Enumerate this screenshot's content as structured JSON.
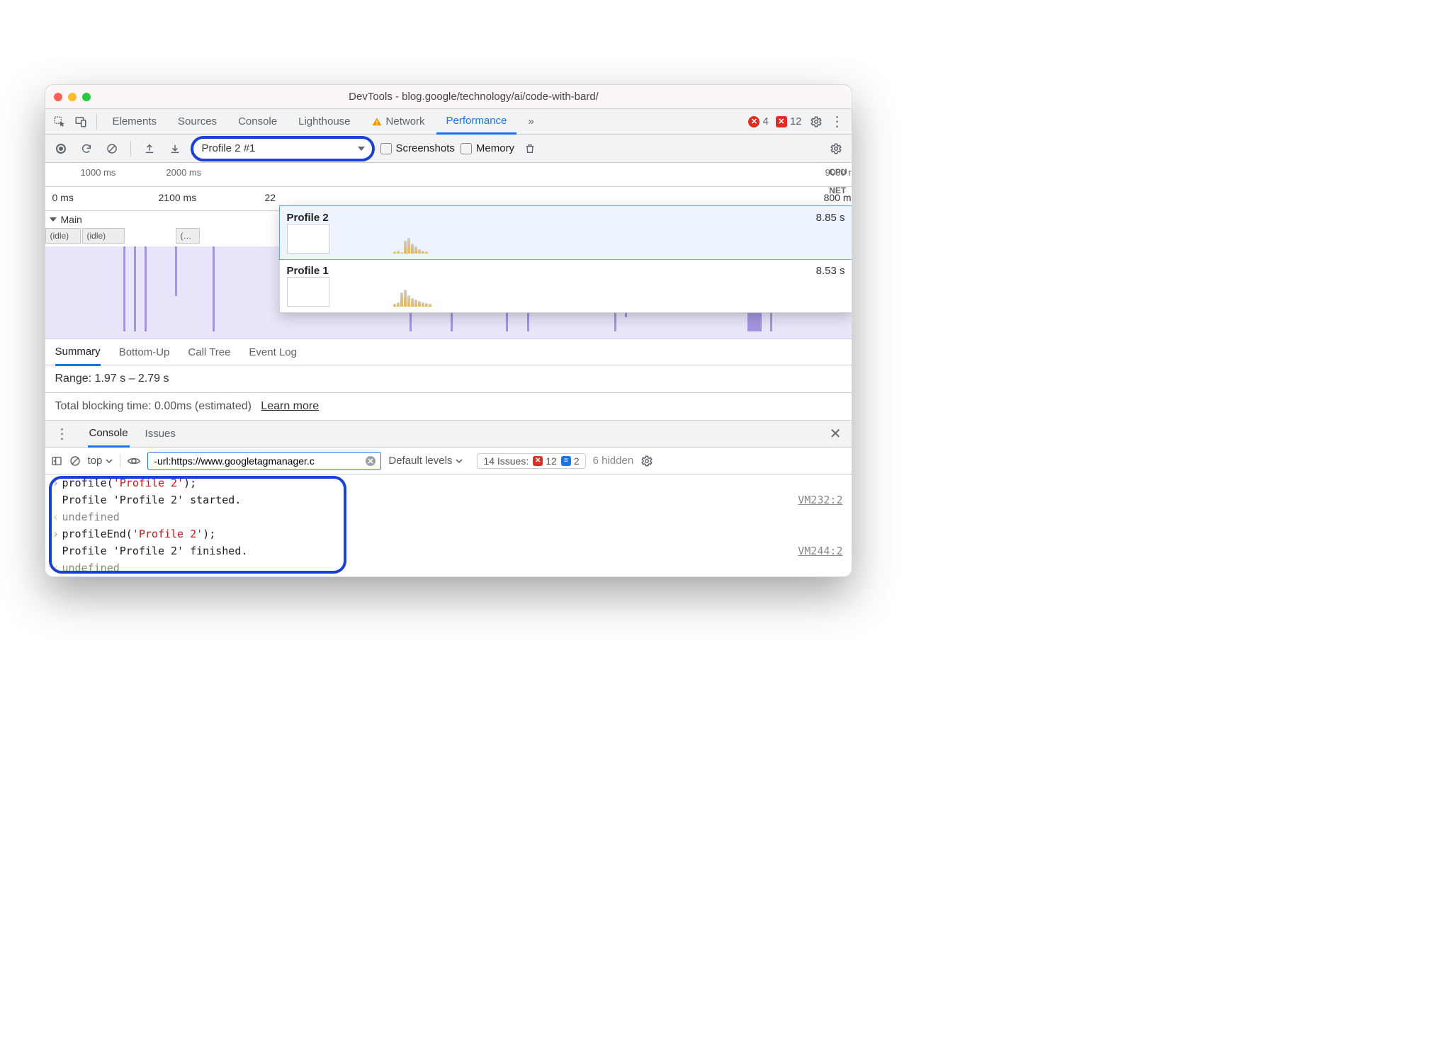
{
  "window": {
    "title": "DevTools - blog.google/technology/ai/code-with-bard/"
  },
  "tabs": {
    "items": [
      "Elements",
      "Sources",
      "Console",
      "Lighthouse",
      "Network",
      "Performance"
    ],
    "active": "Performance",
    "more": "»",
    "error_circle_count": "4",
    "error_square_count": "12"
  },
  "toolbar": {
    "profile_selected": "Profile 2 #1",
    "screenshots_label": "Screenshots",
    "memory_label": "Memory"
  },
  "mini_ruler": [
    "1000 ms",
    "2000 ms",
    "",
    "",
    "",
    "",
    "",
    "",
    "9000 r"
  ],
  "cpu_net": {
    "cpu": "CPU",
    "net": "NET"
  },
  "big_ruler": [
    "0 ms",
    "2100 ms",
    "22",
    "",
    "",
    "",
    "",
    "800 m"
  ],
  "dropdown": [
    {
      "name": "Profile 2",
      "time": "8.85 s"
    },
    {
      "name": "Profile 1",
      "time": "8.53 s"
    }
  ],
  "flame": {
    "main_label": "Main",
    "idle": "(idle)",
    "trunc": "(…"
  },
  "subtabs": [
    "Summary",
    "Bottom-Up",
    "Call Tree",
    "Event Log"
  ],
  "range": "Range: 1.97 s – 2.79 s",
  "blocking": {
    "text": "Total blocking time: 0.00ms (estimated)",
    "link": "Learn more"
  },
  "drawer": {
    "tabs": [
      "Console",
      "Issues"
    ]
  },
  "consolebar": {
    "context": "top",
    "filter": "-url:https://www.googletagmanager.c",
    "levels": "Default levels",
    "issues_label": "14 Issues:",
    "issues_err": "12",
    "issues_msg": "2",
    "hidden": "6 hidden"
  },
  "console_lines": [
    {
      "type": "in",
      "pre": "profile(",
      "str": "'Profile 2'",
      "post": ");"
    },
    {
      "type": "log",
      "text": "Profile 'Profile 2' started.",
      "src": "VM232:2"
    },
    {
      "type": "ret",
      "text": "undefined"
    },
    {
      "type": "in",
      "pre": "profileEnd(",
      "str": "'Profile 2'",
      "post": ");"
    },
    {
      "type": "log",
      "text": "Profile 'Profile 2' finished.",
      "src": "VM244:2"
    },
    {
      "type": "ret",
      "text": "undefined"
    }
  ]
}
